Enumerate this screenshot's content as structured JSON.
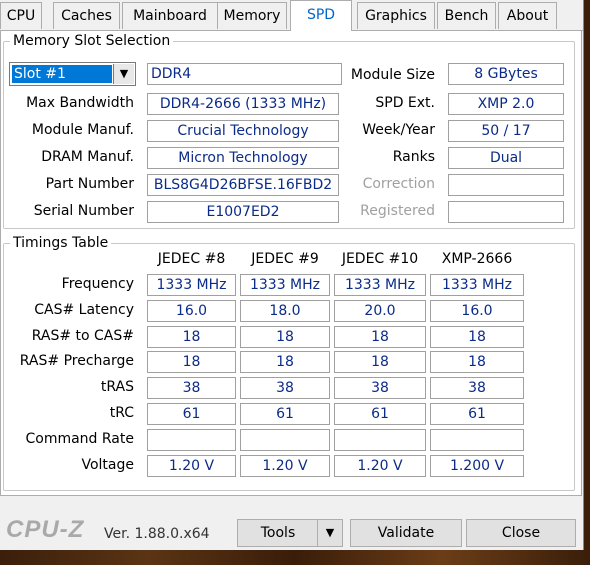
{
  "tabs": [
    "CPU",
    "Caches",
    "Mainboard",
    "Memory",
    "SPD",
    "Graphics",
    "Bench",
    "About"
  ],
  "active_tab": "SPD",
  "slot_group": {
    "title": "Memory Slot Selection",
    "slot_selected": "Slot #1",
    "memory_type": "DDR4",
    "labels": {
      "max_bandwidth": "Max Bandwidth",
      "module_manuf": "Module Manuf.",
      "dram_manuf": "DRAM Manuf.",
      "part_number": "Part Number",
      "serial_number": "Serial Number",
      "module_size": "Module Size",
      "spd_ext": "SPD Ext.",
      "week_year": "Week/Year",
      "ranks": "Ranks",
      "correction": "Correction",
      "registered": "Registered"
    },
    "values": {
      "max_bandwidth": "DDR4-2666 (1333 MHz)",
      "module_manuf": "Crucial Technology",
      "dram_manuf": "Micron Technology",
      "part_number": "BLS8G4D26BFSE.16FBD2",
      "serial_number": "E1007ED2",
      "module_size": "8 GBytes",
      "spd_ext": "XMP 2.0",
      "week_year": "50 / 17",
      "ranks": "Dual",
      "correction": "",
      "registered": ""
    }
  },
  "timings": {
    "title": "Timings Table",
    "columns": [
      "JEDEC #8",
      "JEDEC #9",
      "JEDEC #10",
      "XMP-2666"
    ],
    "rows": [
      {
        "label": "Frequency",
        "values": [
          "1333 MHz",
          "1333 MHz",
          "1333 MHz",
          "1333 MHz"
        ]
      },
      {
        "label": "CAS# Latency",
        "values": [
          "16.0",
          "18.0",
          "20.0",
          "16.0"
        ]
      },
      {
        "label": "RAS# to CAS#",
        "values": [
          "18",
          "18",
          "18",
          "18"
        ]
      },
      {
        "label": "RAS# Precharge",
        "values": [
          "18",
          "18",
          "18",
          "18"
        ]
      },
      {
        "label": "tRAS",
        "values": [
          "38",
          "38",
          "38",
          "38"
        ]
      },
      {
        "label": "tRC",
        "values": [
          "61",
          "61",
          "61",
          "61"
        ]
      },
      {
        "label": "Command Rate",
        "values": [
          "",
          "",
          "",
          ""
        ]
      },
      {
        "label": "Voltage",
        "values": [
          "1.20 V",
          "1.20 V",
          "1.20 V",
          "1.200 V"
        ]
      }
    ]
  },
  "footer": {
    "logo": "CPU-Z",
    "version": "Ver. 1.88.0.x64",
    "tools": "Tools",
    "validate": "Validate",
    "close": "Close"
  }
}
